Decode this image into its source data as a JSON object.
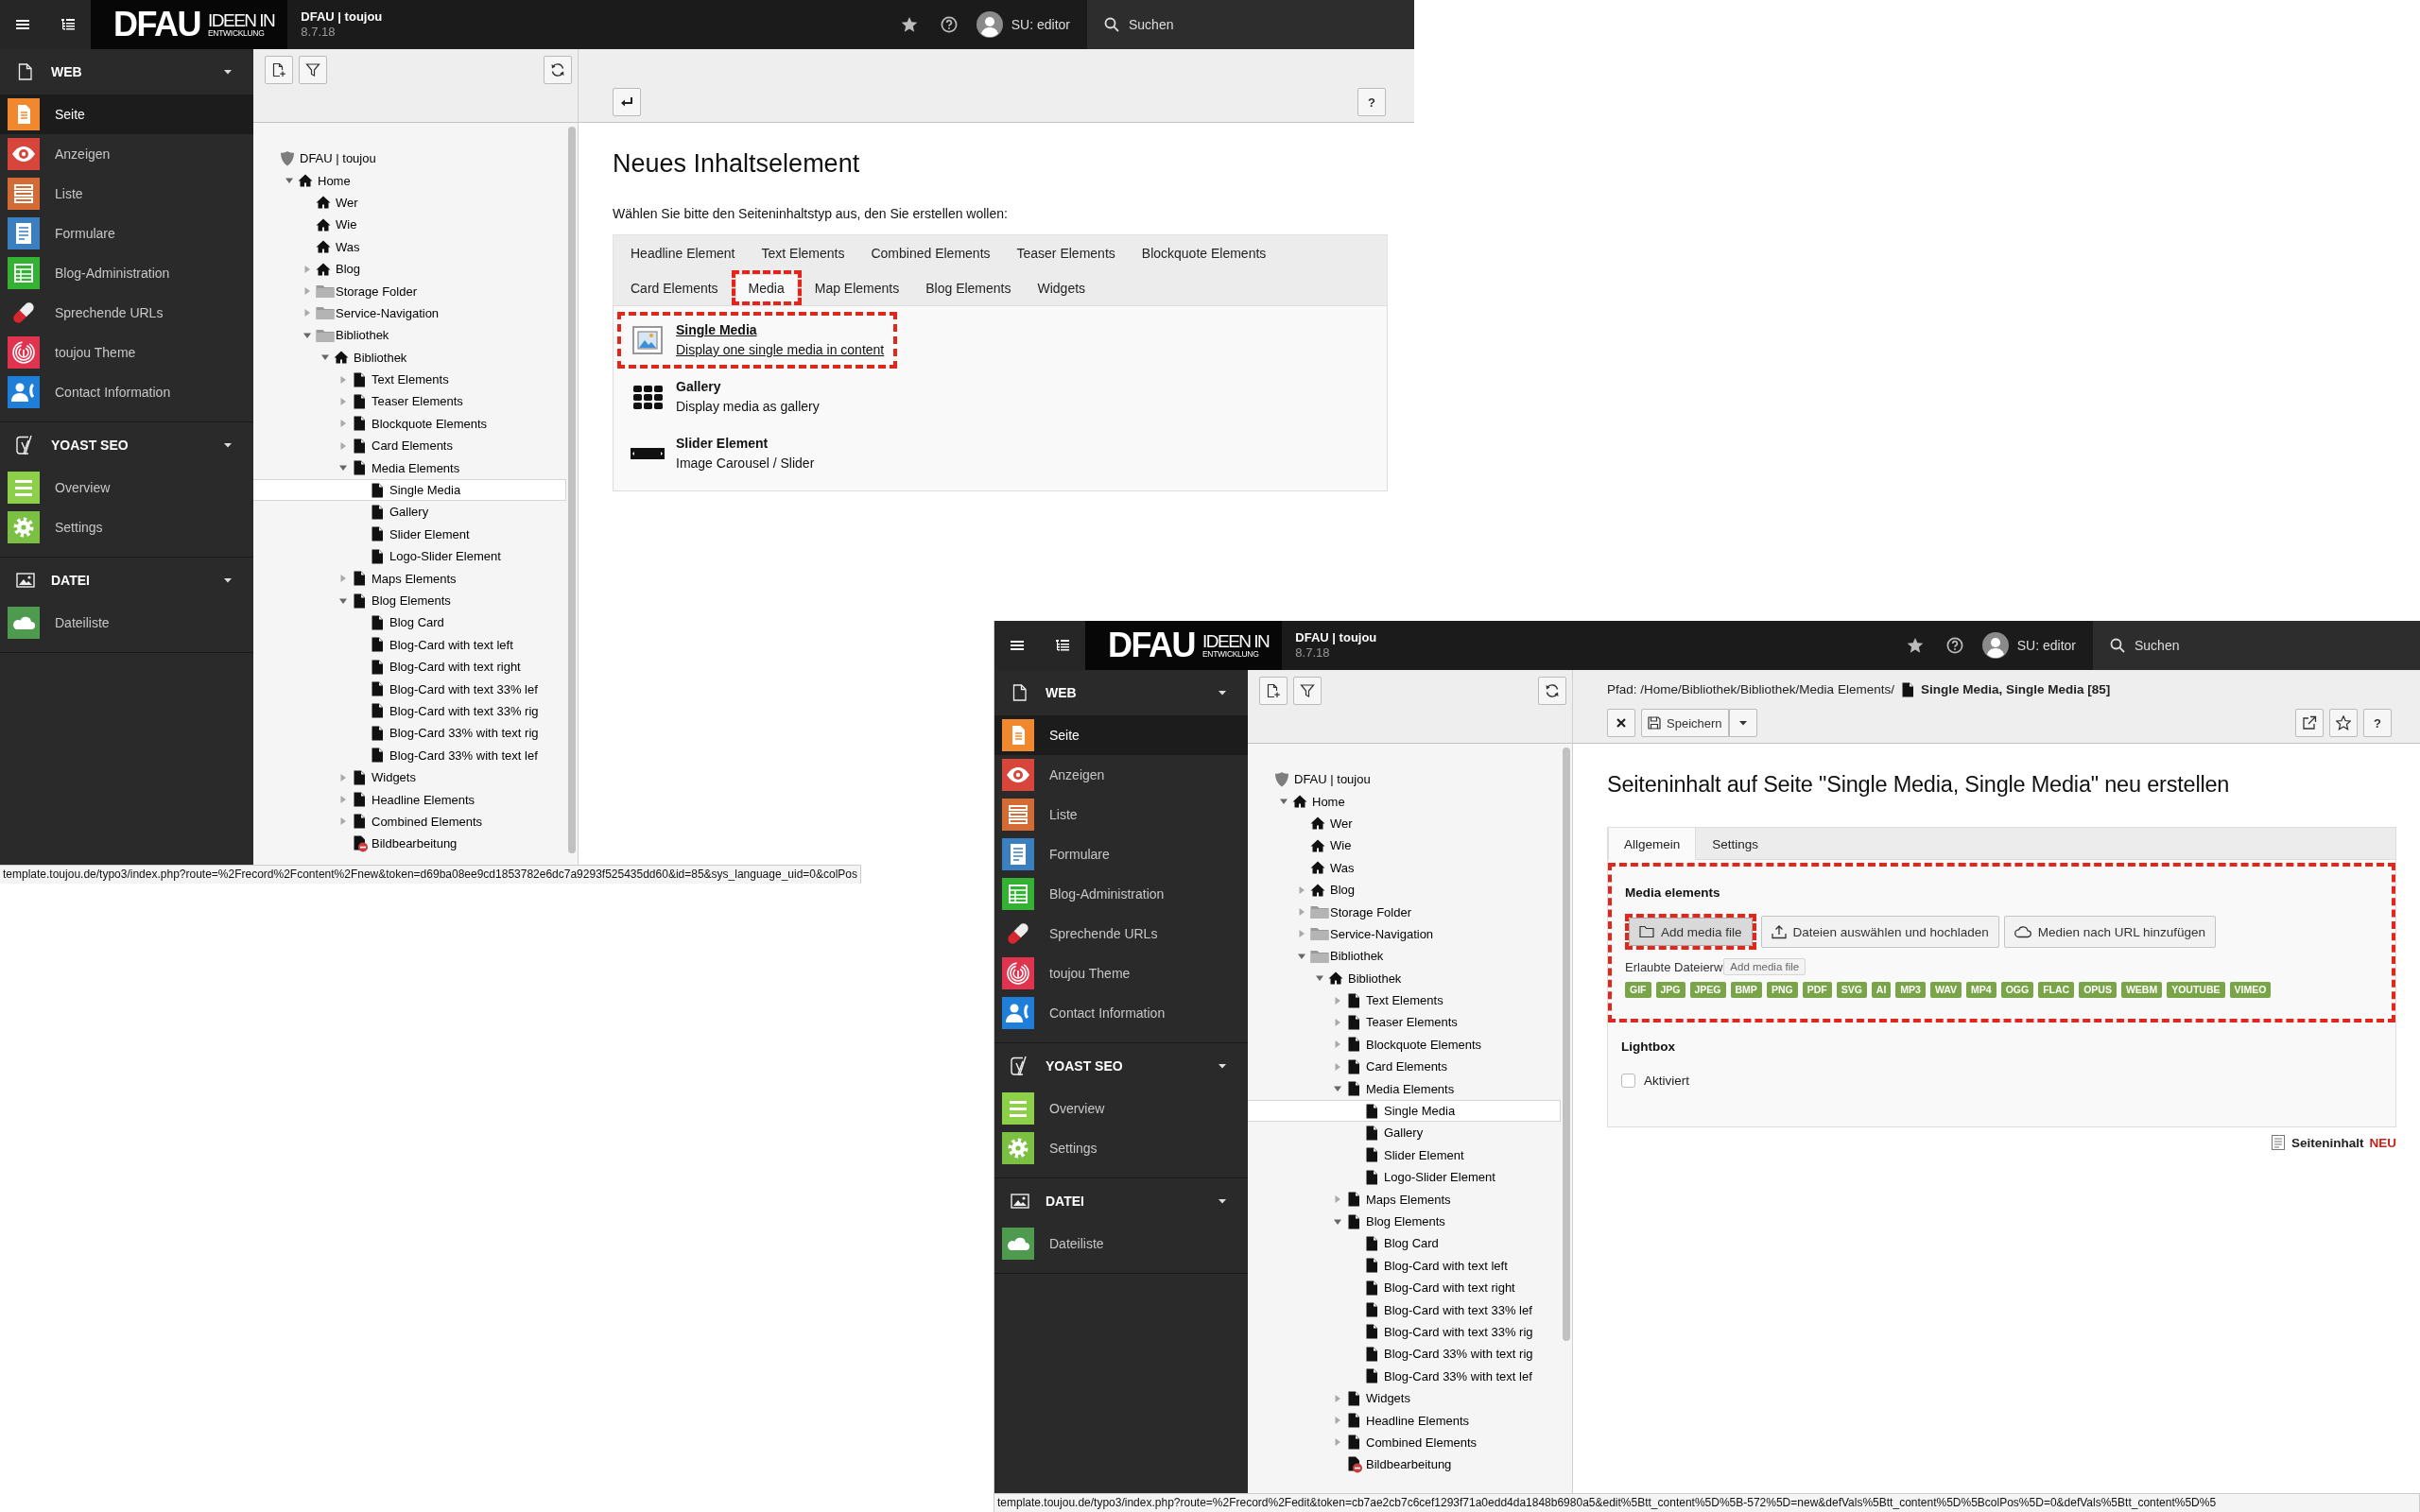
{
  "windows": [
    {
      "topbar": {
        "logo": {
          "mark": "DFAU",
          "line_1": "IDEEN IN",
          "line_2": "ENTWICKLUNG"
        },
        "site_name": "DFAU | toujou",
        "version": "8.7.18",
        "user": "SU: editor",
        "search_label": "Suchen"
      },
      "modules": [
        {
          "label": "WEB",
          "kind": "web",
          "expanded": true,
          "items": [
            {
              "label": "Seite",
              "kind": "page",
              "color": "#f0892e",
              "selected": true
            },
            {
              "label": "Anzeigen",
              "kind": "view",
              "color": "#d7453b",
              "selected": false
            },
            {
              "label": "Liste",
              "kind": "list",
              "color": "#d46a34",
              "selected": false
            },
            {
              "label": "Formulare",
              "kind": "form",
              "color": "#3b7fc0",
              "selected": false
            },
            {
              "label": "Blog-Administration",
              "kind": "blog",
              "color": "#34b234",
              "selected": false
            },
            {
              "label": "Sprechende URLs",
              "kind": "urls",
              "color": "#d8262e",
              "selected": false
            },
            {
              "label": "toujou Theme",
              "kind": "theme",
              "color": "#e0334f",
              "selected": false
            },
            {
              "label": "Contact Information",
              "kind": "contacts",
              "color": "#1f7fd8",
              "selected": false
            }
          ]
        },
        {
          "label": "YOAST SEO",
          "kind": "seo",
          "expanded": true,
          "items": [
            {
              "label": "Overview",
              "kind": "overview",
              "color": "#8cd04a",
              "selected": false
            },
            {
              "label": "Settings",
              "kind": "settings",
              "color": "#7bc043",
              "selected": false
            }
          ]
        },
        {
          "label": "DATEI",
          "kind": "files",
          "expanded": true,
          "items": [
            {
              "label": "Dateiliste",
              "kind": "files",
              "color": "#4e9a4e",
              "selected": false
            }
          ]
        }
      ],
      "tree": [
        {
          "label": "DFAU | toujou",
          "kind": "site",
          "selected": false,
          "children": [
            {
              "label": "Home",
              "kind": "home",
              "expanded": true,
              "selected": false,
              "children": [
                {
                  "label": "Wer",
                  "kind": "home",
                  "selected": false
                },
                {
                  "label": "Wie",
                  "kind": "home",
                  "selected": false
                },
                {
                  "label": "Was",
                  "kind": "home",
                  "selected": false
                },
                {
                  "label": "Blog",
                  "kind": "home",
                  "expanded": false,
                  "selected": false
                },
                {
                  "label": "Storage Folder",
                  "kind": "folder",
                  "expanded": false,
                  "selected": false
                },
                {
                  "label": "Service-Navigation",
                  "kind": "folder",
                  "expanded": false,
                  "selected": false
                },
                {
                  "label": "Bibliothek",
                  "kind": "folder",
                  "expanded": true,
                  "selected": false,
                  "children": [
                    {
                      "label": "Bibliothek",
                      "kind": "home",
                      "expanded": true,
                      "selected": false,
                      "children": [
                        {
                          "label": "Text Elements",
                          "kind": "page",
                          "expanded": false,
                          "selected": false
                        },
                        {
                          "label": "Teaser Elements",
                          "kind": "page",
                          "expanded": false,
                          "selected": false
                        },
                        {
                          "label": "Blockquote Elements",
                          "kind": "page",
                          "expanded": false,
                          "selected": false
                        },
                        {
                          "label": "Card Elements",
                          "kind": "page",
                          "expanded": false,
                          "selected": false
                        },
                        {
                          "label": "Media Elements",
                          "kind": "page",
                          "expanded": true,
                          "selected": false,
                          "children": [
                            {
                              "label": "Single Media",
                              "kind": "page",
                              "selected": true
                            },
                            {
                              "label": "Gallery",
                              "kind": "page",
                              "selected": false
                            },
                            {
                              "label": "Slider Element",
                              "kind": "page",
                              "selected": false
                            },
                            {
                              "label": "Logo-Slider Element",
                              "kind": "page",
                              "selected": false
                            }
                          ]
                        },
                        {
                          "label": "Maps Elements",
                          "kind": "page",
                          "expanded": false,
                          "selected": false
                        },
                        {
                          "label": "Blog Elements",
                          "kind": "page",
                          "expanded": true,
                          "selected": false,
                          "children": [
                            {
                              "label": "Blog Card",
                              "kind": "page",
                              "selected": false
                            },
                            {
                              "label": "Blog-Card with text left",
                              "kind": "page",
                              "selected": false
                            },
                            {
                              "label": "Blog-Card with text right",
                              "kind": "page",
                              "selected": false
                            },
                            {
                              "label": "Blog-Card with text 33% lef",
                              "kind": "page",
                              "selected": false
                            },
                            {
                              "label": "Blog-Card with text 33% rig",
                              "kind": "page",
                              "selected": false
                            },
                            {
                              "label": "Blog-Card 33% with text rig",
                              "kind": "page",
                              "selected": false
                            },
                            {
                              "label": "Blog-Card 33% with text lef",
                              "kind": "page",
                              "selected": false
                            }
                          ]
                        },
                        {
                          "label": "Widgets",
                          "kind": "page",
                          "expanded": false,
                          "selected": false
                        },
                        {
                          "label": "Headline Elements",
                          "kind": "page",
                          "expanded": false,
                          "selected": false
                        },
                        {
                          "label": "Combined Elements",
                          "kind": "page",
                          "expanded": false,
                          "selected": false
                        },
                        {
                          "label": "Bildbearbeitung",
                          "kind": "restricted",
                          "selected": false
                        }
                      ]
                    }
                  ]
                }
              ]
            }
          ]
        }
      ],
      "content": {
        "kind": "new_content_wizard",
        "help_button": "?",
        "title": "Neues Inhaltselement",
        "intro": "Wählen Sie bitte den Seiteninhaltstyp aus, den Sie erstellen wollen:",
        "tabs": [
          {
            "label": "Headline Element",
            "selected": false,
            "highlighted": false
          },
          {
            "label": "Text Elements",
            "selected": false,
            "highlighted": false
          },
          {
            "label": "Combined Elements",
            "selected": false,
            "highlighted": false
          },
          {
            "label": "Teaser Elements",
            "selected": false,
            "highlighted": false
          },
          {
            "label": "Blockquote Elements",
            "selected": false,
            "highlighted": false
          },
          {
            "label": "Card Elements",
            "selected": false,
            "highlighted": false
          },
          {
            "label": "Media",
            "selected": true,
            "highlighted": true
          },
          {
            "label": "Map Elements",
            "selected": false,
            "highlighted": false
          },
          {
            "label": "Blog Elements",
            "selected": false,
            "highlighted": false
          },
          {
            "label": "Widgets",
            "selected": false,
            "highlighted": false
          }
        ],
        "options": [
          {
            "title": "Single Media",
            "description": "Display one single media in content",
            "kind": "image",
            "highlighted": true,
            "hovered": true
          },
          {
            "title": "Gallery",
            "description": "Display media as gallery",
            "kind": "gallery",
            "highlighted": false,
            "hovered": false
          },
          {
            "title": "Slider Element",
            "description": "Image Carousel / Slider",
            "kind": "slider",
            "highlighted": false,
            "hovered": false
          }
        ]
      },
      "status_bar": "template.toujou.de/typo3/index.php?route=%2Frecord%2Fcontent%2Fnew&token=d69ba08ee9cd1853782e6dc7a9293f525435dd60&id=85&sys_language_uid=0&colPos"
    },
    {
      "topbar": {
        "logo": {
          "mark": "DFAU",
          "line_1": "IDEEN IN",
          "line_2": "ENTWICKLUNG"
        },
        "site_name": "DFAU | toujou",
        "version": "8.7.18",
        "user": "SU: editor",
        "search_label": "Suchen"
      },
      "modules": [
        {
          "label": "WEB",
          "kind": "web",
          "expanded": true,
          "items": [
            {
              "label": "Seite",
              "kind": "page",
              "color": "#f0892e",
              "selected": true
            },
            {
              "label": "Anzeigen",
              "kind": "view",
              "color": "#d7453b",
              "selected": false
            },
            {
              "label": "Liste",
              "kind": "list",
              "color": "#d46a34",
              "selected": false
            },
            {
              "label": "Formulare",
              "kind": "form",
              "color": "#3b7fc0",
              "selected": false
            },
            {
              "label": "Blog-Administration",
              "kind": "blog",
              "color": "#34b234",
              "selected": false
            },
            {
              "label": "Sprechende URLs",
              "kind": "urls",
              "color": "#d8262e",
              "selected": false
            },
            {
              "label": "toujou Theme",
              "kind": "theme",
              "color": "#e0334f",
              "selected": false
            },
            {
              "label": "Contact Information",
              "kind": "contacts",
              "color": "#1f7fd8",
              "selected": false
            }
          ]
        },
        {
          "label": "YOAST SEO",
          "kind": "seo",
          "expanded": true,
          "items": [
            {
              "label": "Overview",
              "kind": "overview",
              "color": "#8cd04a",
              "selected": false
            },
            {
              "label": "Settings",
              "kind": "settings",
              "color": "#7bc043",
              "selected": false
            }
          ]
        },
        {
          "label": "DATEI",
          "kind": "files",
          "expanded": true,
          "items": [
            {
              "label": "Dateiliste",
              "kind": "files",
              "color": "#4e9a4e",
              "selected": false
            }
          ]
        }
      ],
      "tree": [
        {
          "label": "DFAU | toujou",
          "kind": "site",
          "selected": false,
          "children": [
            {
              "label": "Home",
              "kind": "home",
              "expanded": true,
              "selected": false,
              "children": [
                {
                  "label": "Wer",
                  "kind": "home",
                  "selected": false
                },
                {
                  "label": "Wie",
                  "kind": "home",
                  "selected": false
                },
                {
                  "label": "Was",
                  "kind": "home",
                  "selected": false
                },
                {
                  "label": "Blog",
                  "kind": "home",
                  "expanded": false,
                  "selected": false
                },
                {
                  "label": "Storage Folder",
                  "kind": "folder",
                  "expanded": false,
                  "selected": false
                },
                {
                  "label": "Service-Navigation",
                  "kind": "folder",
                  "expanded": false,
                  "selected": false
                },
                {
                  "label": "Bibliothek",
                  "kind": "folder",
                  "expanded": true,
                  "selected": false,
                  "children": [
                    {
                      "label": "Bibliothek",
                      "kind": "home",
                      "expanded": true,
                      "selected": false,
                      "children": [
                        {
                          "label": "Text Elements",
                          "kind": "page",
                          "expanded": false,
                          "selected": false
                        },
                        {
                          "label": "Teaser Elements",
                          "kind": "page",
                          "expanded": false,
                          "selected": false
                        },
                        {
                          "label": "Blockquote Elements",
                          "kind": "page",
                          "expanded": false,
                          "selected": false
                        },
                        {
                          "label": "Card Elements",
                          "kind": "page",
                          "expanded": false,
                          "selected": false
                        },
                        {
                          "label": "Media Elements",
                          "kind": "page",
                          "expanded": true,
                          "selected": false,
                          "children": [
                            {
                              "label": "Single Media",
                              "kind": "page",
                              "selected": true
                            },
                            {
                              "label": "Gallery",
                              "kind": "page",
                              "selected": false
                            },
                            {
                              "label": "Slider Element",
                              "kind": "page",
                              "selected": false
                            },
                            {
                              "label": "Logo-Slider Element",
                              "kind": "page",
                              "selected": false
                            }
                          ]
                        },
                        {
                          "label": "Maps Elements",
                          "kind": "page",
                          "expanded": false,
                          "selected": false
                        },
                        {
                          "label": "Blog Elements",
                          "kind": "page",
                          "expanded": true,
                          "selected": false,
                          "children": [
                            {
                              "label": "Blog Card",
                              "kind": "page",
                              "selected": false
                            },
                            {
                              "label": "Blog-Card with text left",
                              "kind": "page",
                              "selected": false
                            },
                            {
                              "label": "Blog-Card with text right",
                              "kind": "page",
                              "selected": false
                            },
                            {
                              "label": "Blog-Card with text 33% lef",
                              "kind": "page",
                              "selected": false
                            },
                            {
                              "label": "Blog-Card with text 33% rig",
                              "kind": "page",
                              "selected": false
                            },
                            {
                              "label": "Blog-Card 33% with text rig",
                              "kind": "page",
                              "selected": false
                            },
                            {
                              "label": "Blog-Card 33% with text lef",
                              "kind": "page",
                              "selected": false
                            }
                          ]
                        },
                        {
                          "label": "Widgets",
                          "kind": "page",
                          "expanded": false,
                          "selected": false
                        },
                        {
                          "label": "Headline Elements",
                          "kind": "page",
                          "expanded": false,
                          "selected": false
                        },
                        {
                          "label": "Combined Elements",
                          "kind": "page",
                          "expanded": false,
                          "selected": false
                        },
                        {
                          "label": "Bildbearbeitung",
                          "kind": "restricted",
                          "selected": false
                        }
                      ]
                    }
                  ]
                }
              ]
            }
          ]
        }
      ],
      "content": {
        "kind": "record_edit",
        "path_label": "Pfad: /Home/Bibliothek/Bibliothek/Media Elements/",
        "record_title": "Single Media, Single Media [85]",
        "save_label": "Speichern",
        "help_button": "?",
        "title": "Seiteninhalt auf Seite \"Single Media, Single Media\" neu erstellen",
        "tabs": [
          {
            "label": "Allgemein",
            "selected": true
          },
          {
            "label": "Settings",
            "selected": false
          }
        ],
        "sections": [
          {
            "kind": "media",
            "label": "Media elements",
            "highlighted": true,
            "buttons": [
              {
                "label": "Add media file",
                "kind": "folder",
                "highlighted": true,
                "pressed": true
              },
              {
                "label": "Dateien auswählen und hochladen",
                "kind": "upload",
                "highlighted": false,
                "pressed": false
              },
              {
                "label": "Medien nach URL hinzufügen",
                "kind": "cloud",
                "highlighted": false,
                "pressed": false
              }
            ],
            "allowed_label": "Erlaubte Dateierw",
            "tooltip": "Add media file",
            "extensions": [
              "GIF",
              "JPG",
              "JPEG",
              "BMP",
              "PNG",
              "PDF",
              "SVG",
              "AI",
              "MP3",
              "WAV",
              "MP4",
              "OGG",
              "FLAC",
              "OPUS",
              "WEBM",
              "YOUTUBE",
              "VIMEO"
            ]
          },
          {
            "kind": "checkbox",
            "label": "Lightbox",
            "highlighted": false,
            "option": "Aktiviert",
            "checked": false
          }
        ],
        "footer": {
          "record_type": "Seiteninhalt",
          "status": "NEU"
        }
      },
      "status_bar": "template.toujou.de/typo3/index.php?route=%2Frecord%2Fedit&token=cb7ae2cb7c6cef1293f71a0edd4da1848b6980a5&edit%5Btt_content%5D%5B-572%5D=new&defVals%5Btt_content%5D%5BcolPos%5D=0&defVals%5Btt_content%5D%5"
    }
  ]
}
